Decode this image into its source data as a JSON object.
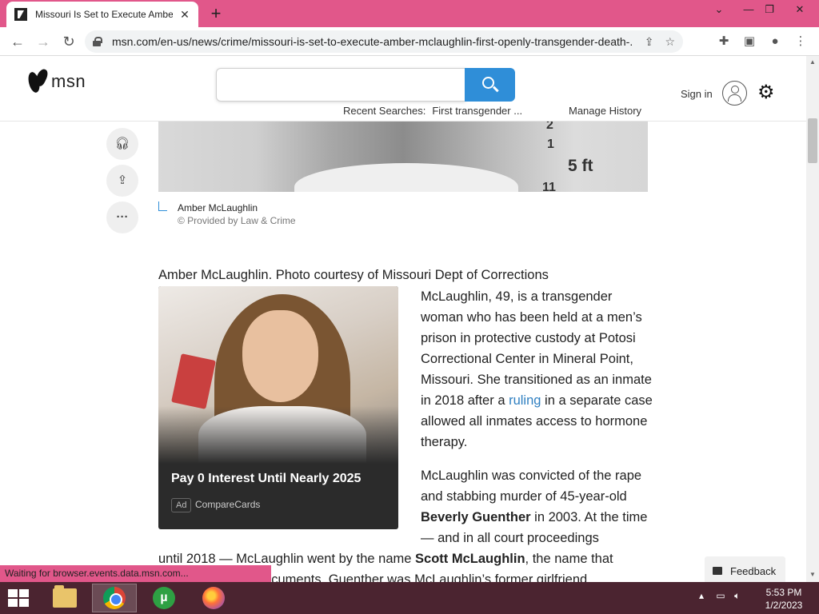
{
  "browser": {
    "tab_title": "Missouri Is Set to Execute Amber McLaughlin First Openly Transgender Death Row Inmate",
    "tab_close": "✕",
    "new_tab": "+",
    "url": "msn.com/en-us/news/crime/missouri-is-set-to-execute-amber-mclaughlin-first-openly-transgender-death-...",
    "status_text": "Waiting for browser.events.data.msn.com...",
    "win_controls": [
      "⌄",
      "—",
      "❐",
      "✕"
    ]
  },
  "msn": {
    "logo_text": "msn",
    "search_placeholder": "",
    "recent_label": "Recent Searches:",
    "recent_term": "First transgender ...",
    "manage_history": "Manage History",
    "sign_in": "Sign in"
  },
  "article": {
    "mugshot_marks": [
      "2",
      "1",
      "5 ft",
      "11"
    ],
    "image_caption": "Amber McLaughlin",
    "image_credit": "© Provided by Law & Crime",
    "photo_line": "Amber McLaughlin. Photo courtesy of Missouri Dept of Corrections",
    "p1_before": "McLaughlin, 49, is a transgender woman who has been held at a men’s prison in protective custody at Potosi Correctional Center in Mineral Point, Missouri. She transitioned as an inmate in 2018 after a ",
    "p1_link": "ruling",
    "p1_after": " in a separate case allowed all inmates access to hormone therapy.",
    "p2_before": "McLaughlin was convicted of the rape and stabbing murder of 45-year-old ",
    "p2_bold": "Beverly Guenther",
    "p2_after": " in 2003. At the time — and in all court proceedings",
    "p3_before": "until 2018 — McLaughlin went by the name ",
    "p3_bold": "Scott McLaughlin",
    "p3_after": ", the name that appears in court documents. Guenther was McLaughlin’s former girlfriend."
  },
  "ad": {
    "title": "Pay 0 Interest Until Nearly 2025",
    "tag": "Ad",
    "source": "CompareCards"
  },
  "feedback": "Feedback",
  "taskbar": {
    "time": "5:53 PM",
    "date": "1/2/2023"
  },
  "colors": {
    "browser_frame": "#e1578a",
    "msn_search_blue": "#2f8ed8",
    "link_blue": "#2f7fc1",
    "taskbar": "#4b2430"
  }
}
